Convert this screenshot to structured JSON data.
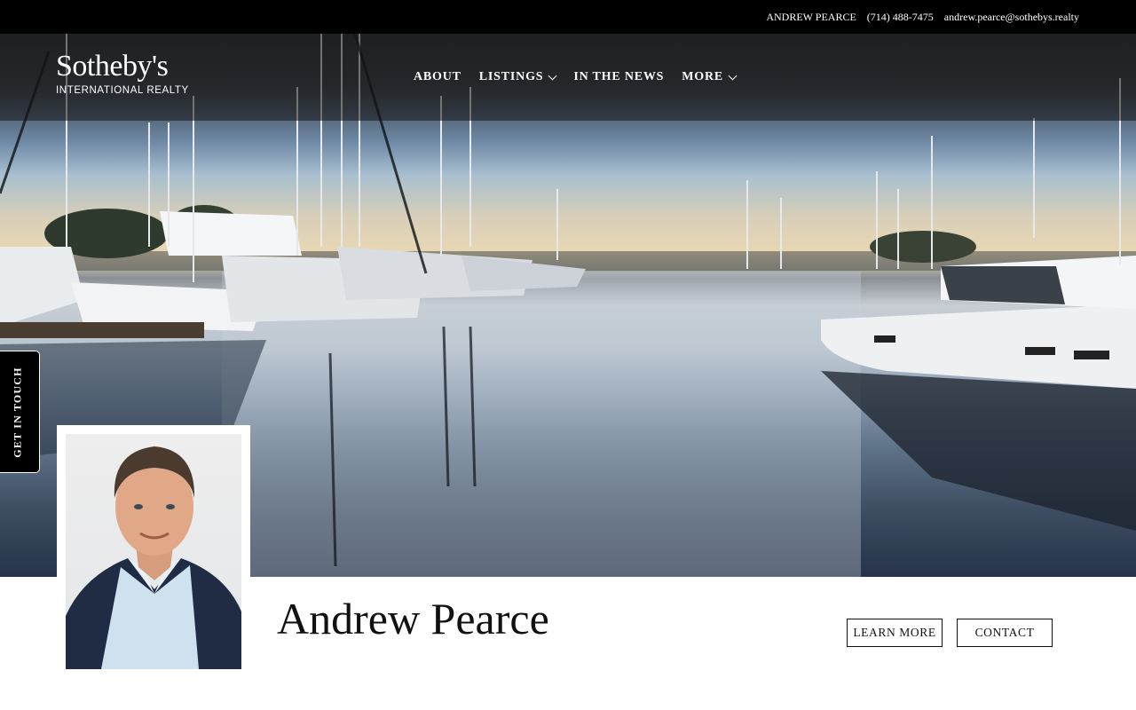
{
  "topbar": {
    "agent_name": "ANDREW PEARCE",
    "phone": "(714) 488-7475",
    "email": "andrew.pearce@sothebys.realty"
  },
  "brand": {
    "name": "Sotheby's",
    "subtitle": "INTERNATIONAL REALTY"
  },
  "nav": {
    "items": [
      {
        "label": "ABOUT",
        "has_dropdown": false
      },
      {
        "label": "LISTINGS",
        "has_dropdown": true
      },
      {
        "label": "IN THE NEWS",
        "has_dropdown": false
      },
      {
        "label": "MORE",
        "has_dropdown": true
      }
    ]
  },
  "side_tab": {
    "label": "GET IN TOUCH"
  },
  "hero": {
    "image": "marina-harbor-photo"
  },
  "agent": {
    "name": "Andrew Pearce",
    "photo": "agent-portrait-photo"
  },
  "actions": {
    "learn_more": "LEARN MORE",
    "contact": "CONTACT"
  },
  "colors": {
    "topbar_bg": "#000000",
    "nav_overlay": "rgba(20,20,22,0.55)",
    "text_dark": "#111111",
    "text_light": "#ffffff"
  }
}
